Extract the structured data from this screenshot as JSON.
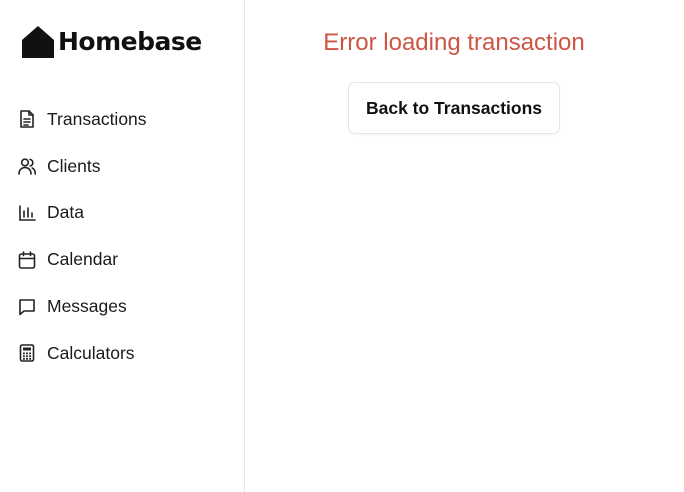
{
  "app": {
    "brand": "Homebase",
    "brand_icon": "house-icon"
  },
  "sidebar": {
    "items": [
      {
        "label": "Transactions",
        "icon": "document-icon"
      },
      {
        "label": "Clients",
        "icon": "users-icon"
      },
      {
        "label": "Data",
        "icon": "bar-chart-icon"
      },
      {
        "label": "Calendar",
        "icon": "calendar-icon"
      },
      {
        "label": "Messages",
        "icon": "message-icon"
      },
      {
        "label": "Calculators",
        "icon": "calculator-icon"
      }
    ]
  },
  "main": {
    "error_message": "Error loading transaction",
    "back_button_label": "Back to Transactions"
  },
  "colors": {
    "error": "#cc5544",
    "text": "#111111",
    "border": "#e5e5e5"
  }
}
